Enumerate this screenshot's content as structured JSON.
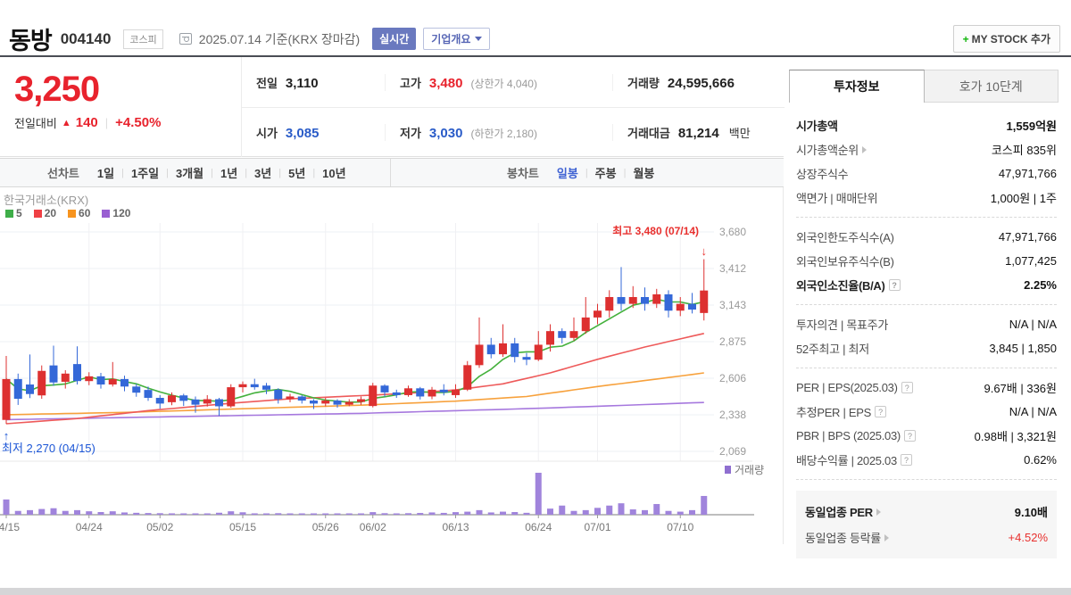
{
  "header": {
    "title": "동방",
    "code": "004140",
    "market_badge": "코스피",
    "date_info": "2025.07.14 기준(KRX 장마감)",
    "realtime_badge": "실시간",
    "overview_button": "기업개요",
    "mystock_button": "MY STOCK 추가",
    "mystock_plus": "+"
  },
  "price": {
    "current": "3,250",
    "change_label": "전일대비",
    "up_triangle": "▲",
    "change_value": "140",
    "change_percent": "+4.50%"
  },
  "quote": {
    "prev": {
      "label": "전일",
      "value": "3,110"
    },
    "high": {
      "label": "고가",
      "value": "3,480",
      "extra": "(상한가 4,040)"
    },
    "volume": {
      "label": "거래량",
      "value": "24,595,666"
    },
    "open": {
      "label": "시가",
      "value": "3,085"
    },
    "low": {
      "label": "저가",
      "value": "3,030",
      "extra": "(하한가 2,180)"
    },
    "amount": {
      "label": "거래대금",
      "value": "81,214",
      "unit": "백만"
    }
  },
  "tabs": {
    "left": [
      {
        "label": "선차트",
        "kind": "label"
      },
      {
        "label": "1일"
      },
      {
        "label": "1주일"
      },
      {
        "label": "3개월"
      },
      {
        "label": "1년"
      },
      {
        "label": "3년"
      },
      {
        "label": "5년"
      },
      {
        "label": "10년"
      }
    ],
    "right": [
      {
        "label": "봉차트",
        "kind": "label"
      },
      {
        "label": "일봉",
        "active": true
      },
      {
        "label": "주봉"
      },
      {
        "label": "월봉"
      }
    ]
  },
  "chart_data": {
    "type": "candlestick",
    "exchange_label": "한국거래소(KRX)",
    "ma_legend": [
      {
        "label": "5",
        "color": "#3fae49"
      },
      {
        "label": "20",
        "color": "#ef4045"
      },
      {
        "label": "60",
        "color": "#f7941f"
      },
      {
        "label": "120",
        "color": "#9a5fd2"
      }
    ],
    "colors": {
      "up": "#dd3030",
      "down": "#3468d8",
      "volume": "#a084dc",
      "ma5": "#44b13c",
      "ma20": "#ee5a5a",
      "ma60": "#f7a13c",
      "ma120": "#a678de",
      "annotation_high": "#e8302e",
      "annotation_low": "#1b55d6"
    },
    "y_axis": {
      "top_value": 3680,
      "step": 268.5,
      "labels": [
        "3,680",
        "3,412",
        "3,143",
        "2,875",
        "2,606",
        "2,338",
        "2,069"
      ]
    },
    "x_ticks": [
      [
        0,
        "04/15"
      ],
      [
        7,
        "04/24"
      ],
      [
        13,
        "05/02"
      ],
      [
        20,
        "05/15"
      ],
      [
        27,
        "05/26"
      ],
      [
        31,
        "06/02"
      ],
      [
        38,
        "06/13"
      ],
      [
        45,
        "06/24"
      ],
      [
        50,
        "07/01"
      ],
      [
        57,
        "07/10"
      ]
    ],
    "annotations": {
      "high": {
        "text": "최고 3,480 (07/14)",
        "arrow": "↓"
      },
      "low": {
        "text": "최저 2,270 (04/15)",
        "arrow": "↑"
      }
    },
    "volume_legend": "거래량",
    "candles": [
      [
        2300,
        2770,
        2270,
        2600,
        20.0
      ],
      [
        2600,
        2640,
        2410,
        2455,
        5.0
      ],
      [
        2560,
        2780,
        2460,
        2490,
        6.0
      ],
      [
        2480,
        2700,
        2455,
        2660,
        7.5
      ],
      [
        2700,
        2845,
        2550,
        2575,
        8.5
      ],
      [
        2580,
        2665,
        2530,
        2640,
        5.0
      ],
      [
        2710,
        2840,
        2560,
        2585,
        6.0
      ],
      [
        2585,
        2650,
        2555,
        2620,
        4.5
      ],
      [
        2620,
        2645,
        2530,
        2560,
        3.5
      ],
      [
        2560,
        2725,
        2545,
        2600,
        4.5
      ],
      [
        2600,
        2625,
        2510,
        2545,
        3.0
      ],
      [
        2545,
        2565,
        2470,
        2500,
        2.5
      ],
      [
        2520,
        2545,
        2440,
        2462,
        2.2
      ],
      [
        2462,
        2482,
        2382,
        2420,
        2.0
      ],
      [
        2430,
        2502,
        2408,
        2480,
        1.8
      ],
      [
        2480,
        2492,
        2402,
        2440,
        1.5
      ],
      [
        2450,
        2472,
        2352,
        2412,
        1.6
      ],
      [
        2420,
        2482,
        2398,
        2452,
        1.4
      ],
      [
        2452,
        2462,
        2330,
        2400,
        2.6
      ],
      [
        2400,
        2562,
        2390,
        2540,
        4.5
      ],
      [
        2540,
        2582,
        2502,
        2562,
        3.2
      ],
      [
        2562,
        2602,
        2522,
        2540,
        1.8
      ],
      [
        2552,
        2572,
        2490,
        2522,
        1.5
      ],
      [
        2522,
        2532,
        2420,
        2452,
        2.0
      ],
      [
        2452,
        2492,
        2430,
        2472,
        1.3
      ],
      [
        2472,
        2482,
        2420,
        2442,
        1.1
      ],
      [
        2442,
        2452,
        2380,
        2420,
        1.4
      ],
      [
        2420,
        2462,
        2400,
        2442,
        1.1
      ],
      [
        2442,
        2452,
        2390,
        2412,
        1.0
      ],
      [
        2412,
        2452,
        2400,
        2432,
        1.0
      ],
      [
        2432,
        2472,
        2410,
        2452,
        1.2
      ],
      [
        2402,
        2572,
        2392,
        2552,
        3.4
      ],
      [
        2552,
        2562,
        2470,
        2502,
        2.0
      ],
      [
        2502,
        2522,
        2462,
        2482,
        1.4
      ],
      [
        2482,
        2552,
        2470,
        2532,
        2.0
      ],
      [
        2532,
        2542,
        2450,
        2472,
        2.3
      ],
      [
        2472,
        2542,
        2452,
        2522,
        3.0
      ],
      [
        2522,
        2562,
        2480,
        2502,
        2.4
      ],
      [
        2482,
        2562,
        2462,
        2522,
        3.4
      ],
      [
        2522,
        2732,
        2512,
        2702,
        4.0
      ],
      [
        2702,
        3052,
        2682,
        2852,
        6.0
      ],
      [
        2852,
        2902,
        2752,
        2782,
        3.0
      ],
      [
        2782,
        3002,
        2762,
        2862,
        4.0
      ],
      [
        2862,
        2902,
        2722,
        2762,
        3.5
      ],
      [
        2762,
        2792,
        2702,
        2742,
        2.5
      ],
      [
        2742,
        2952,
        2732,
        2852,
        55.0
      ],
      [
        2852,
        3002,
        2802,
        2952,
        8.0
      ],
      [
        2952,
        2972,
        2862,
        2902,
        12.0
      ],
      [
        2902,
        3052,
        2882,
        2952,
        5.0
      ],
      [
        2952,
        3202,
        2932,
        3052,
        6.0
      ],
      [
        3052,
        3152,
        3002,
        3102,
        9.0
      ],
      [
        3102,
        3252,
        3052,
        3202,
        12.0
      ],
      [
        3202,
        3422,
        3102,
        3152,
        15.0
      ],
      [
        3152,
        3282,
        3122,
        3202,
        7.0
      ],
      [
        3202,
        3272,
        3102,
        3152,
        6.0
      ],
      [
        3152,
        3262,
        3122,
        3222,
        14.0
      ],
      [
        3222,
        3252,
        3052,
        3102,
        5.0
      ],
      [
        3102,
        3202,
        3062,
        3152,
        4.0
      ],
      [
        3152,
        3232,
        3082,
        3110,
        6.0
      ],
      [
        3085,
        3480,
        3030,
        3250,
        24.6
      ]
    ],
    "ma20_points": [
      [
        0,
        2272
      ],
      [
        6,
        2310
      ],
      [
        12,
        2368
      ],
      [
        18,
        2415
      ],
      [
        24,
        2455
      ],
      [
        30,
        2478
      ],
      [
        34,
        2495
      ],
      [
        38,
        2520
      ],
      [
        42,
        2565
      ],
      [
        46,
        2645
      ],
      [
        50,
        2745
      ],
      [
        54,
        2835
      ],
      [
        57,
        2895
      ],
      [
        59,
        2935
      ]
    ],
    "ma60_points": [
      [
        0,
        2338
      ],
      [
        10,
        2355
      ],
      [
        20,
        2382
      ],
      [
        30,
        2408
      ],
      [
        38,
        2438
      ],
      [
        44,
        2472
      ],
      [
        50,
        2545
      ],
      [
        55,
        2600
      ],
      [
        59,
        2645
      ]
    ],
    "ma120_points": [
      [
        0,
        2302
      ],
      [
        15,
        2325
      ],
      [
        30,
        2348
      ],
      [
        45,
        2385
      ],
      [
        59,
        2428
      ]
    ]
  },
  "panel": {
    "tabs": [
      {
        "label": "투자정보",
        "active": true
      },
      {
        "label": "호가 10단계",
        "active": false
      }
    ],
    "sections": [
      {
        "rows": [
          {
            "l": "시가총액",
            "lb": true,
            "v": "1,559억원",
            "vb": true
          },
          {
            "l": "시가총액순위",
            "arrow": true,
            "v": "코스피 835위"
          },
          {
            "l": "상장주식수",
            "v": "47,971,766"
          },
          {
            "l": "액면가 | 매매단위",
            "v": "1,000원 | 1주"
          }
        ]
      },
      {
        "rows": [
          {
            "l": "외국인한도주식수(A)",
            "v": "47,971,766"
          },
          {
            "l": "외국인보유주식수(B)",
            "v": "1,077,425"
          },
          {
            "l": "외국인소진율(B/A)",
            "lb": true,
            "q": true,
            "v": "2.25%",
            "vb": true
          }
        ]
      },
      {
        "rows": [
          {
            "l": "투자의견 | 목표주가",
            "v": "N/A | N/A"
          },
          {
            "l": "52주최고 | 최저",
            "v": "3,845 | 1,850"
          }
        ]
      },
      {
        "rows": [
          {
            "l": "PER | EPS(2025.03)",
            "q": true,
            "v": "9.67배 | 336원"
          },
          {
            "l": "추정PER | EPS",
            "q": true,
            "v": "N/A | N/A"
          },
          {
            "l": "PBR | BPS (2025.03)",
            "q": true,
            "v": "0.98배 | 3,321원"
          },
          {
            "l": "배당수익률 | 2025.03",
            "q": true,
            "v": "0.62%"
          }
        ]
      },
      {
        "gray": true,
        "rows": [
          {
            "l": "동일업종 PER",
            "lb": true,
            "arrow": true,
            "v": "9.10배",
            "vb": true
          },
          {
            "l": "동일업종 등락률",
            "arrow": true,
            "v": "+4.52%",
            "vr": true
          }
        ]
      }
    ]
  }
}
